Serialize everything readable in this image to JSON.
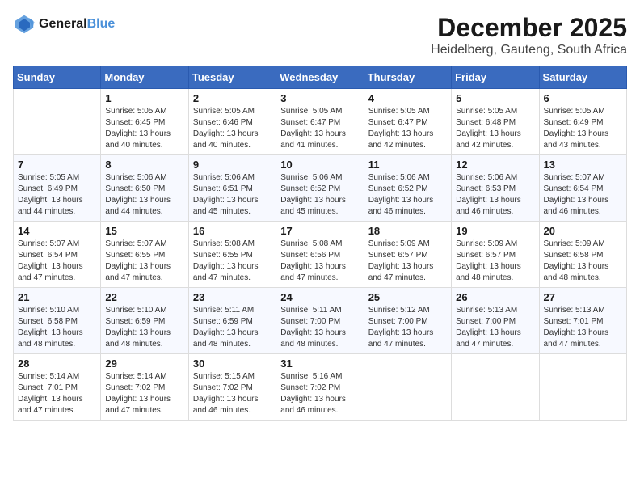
{
  "logo": {
    "line1": "General",
    "line2": "Blue"
  },
  "title": "December 2025",
  "location": "Heidelberg, Gauteng, South Africa",
  "days_of_week": [
    "Sunday",
    "Monday",
    "Tuesday",
    "Wednesday",
    "Thursday",
    "Friday",
    "Saturday"
  ],
  "weeks": [
    [
      {
        "day": "",
        "content": ""
      },
      {
        "day": "1",
        "content": "Sunrise: 5:05 AM\nSunset: 6:45 PM\nDaylight: 13 hours\nand 40 minutes."
      },
      {
        "day": "2",
        "content": "Sunrise: 5:05 AM\nSunset: 6:46 PM\nDaylight: 13 hours\nand 40 minutes."
      },
      {
        "day": "3",
        "content": "Sunrise: 5:05 AM\nSunset: 6:47 PM\nDaylight: 13 hours\nand 41 minutes."
      },
      {
        "day": "4",
        "content": "Sunrise: 5:05 AM\nSunset: 6:47 PM\nDaylight: 13 hours\nand 42 minutes."
      },
      {
        "day": "5",
        "content": "Sunrise: 5:05 AM\nSunset: 6:48 PM\nDaylight: 13 hours\nand 42 minutes."
      },
      {
        "day": "6",
        "content": "Sunrise: 5:05 AM\nSunset: 6:49 PM\nDaylight: 13 hours\nand 43 minutes."
      }
    ],
    [
      {
        "day": "7",
        "content": "Sunrise: 5:05 AM\nSunset: 6:49 PM\nDaylight: 13 hours\nand 44 minutes."
      },
      {
        "day": "8",
        "content": "Sunrise: 5:06 AM\nSunset: 6:50 PM\nDaylight: 13 hours\nand 44 minutes."
      },
      {
        "day": "9",
        "content": "Sunrise: 5:06 AM\nSunset: 6:51 PM\nDaylight: 13 hours\nand 45 minutes."
      },
      {
        "day": "10",
        "content": "Sunrise: 5:06 AM\nSunset: 6:52 PM\nDaylight: 13 hours\nand 45 minutes."
      },
      {
        "day": "11",
        "content": "Sunrise: 5:06 AM\nSunset: 6:52 PM\nDaylight: 13 hours\nand 46 minutes."
      },
      {
        "day": "12",
        "content": "Sunrise: 5:06 AM\nSunset: 6:53 PM\nDaylight: 13 hours\nand 46 minutes."
      },
      {
        "day": "13",
        "content": "Sunrise: 5:07 AM\nSunset: 6:54 PM\nDaylight: 13 hours\nand 46 minutes."
      }
    ],
    [
      {
        "day": "14",
        "content": "Sunrise: 5:07 AM\nSunset: 6:54 PM\nDaylight: 13 hours\nand 47 minutes."
      },
      {
        "day": "15",
        "content": "Sunrise: 5:07 AM\nSunset: 6:55 PM\nDaylight: 13 hours\nand 47 minutes."
      },
      {
        "day": "16",
        "content": "Sunrise: 5:08 AM\nSunset: 6:55 PM\nDaylight: 13 hours\nand 47 minutes."
      },
      {
        "day": "17",
        "content": "Sunrise: 5:08 AM\nSunset: 6:56 PM\nDaylight: 13 hours\nand 47 minutes."
      },
      {
        "day": "18",
        "content": "Sunrise: 5:09 AM\nSunset: 6:57 PM\nDaylight: 13 hours\nand 47 minutes."
      },
      {
        "day": "19",
        "content": "Sunrise: 5:09 AM\nSunset: 6:57 PM\nDaylight: 13 hours\nand 48 minutes."
      },
      {
        "day": "20",
        "content": "Sunrise: 5:09 AM\nSunset: 6:58 PM\nDaylight: 13 hours\nand 48 minutes."
      }
    ],
    [
      {
        "day": "21",
        "content": "Sunrise: 5:10 AM\nSunset: 6:58 PM\nDaylight: 13 hours\nand 48 minutes."
      },
      {
        "day": "22",
        "content": "Sunrise: 5:10 AM\nSunset: 6:59 PM\nDaylight: 13 hours\nand 48 minutes."
      },
      {
        "day": "23",
        "content": "Sunrise: 5:11 AM\nSunset: 6:59 PM\nDaylight: 13 hours\nand 48 minutes."
      },
      {
        "day": "24",
        "content": "Sunrise: 5:11 AM\nSunset: 7:00 PM\nDaylight: 13 hours\nand 48 minutes."
      },
      {
        "day": "25",
        "content": "Sunrise: 5:12 AM\nSunset: 7:00 PM\nDaylight: 13 hours\nand 47 minutes."
      },
      {
        "day": "26",
        "content": "Sunrise: 5:13 AM\nSunset: 7:00 PM\nDaylight: 13 hours\nand 47 minutes."
      },
      {
        "day": "27",
        "content": "Sunrise: 5:13 AM\nSunset: 7:01 PM\nDaylight: 13 hours\nand 47 minutes."
      }
    ],
    [
      {
        "day": "28",
        "content": "Sunrise: 5:14 AM\nSunset: 7:01 PM\nDaylight: 13 hours\nand 47 minutes."
      },
      {
        "day": "29",
        "content": "Sunrise: 5:14 AM\nSunset: 7:02 PM\nDaylight: 13 hours\nand 47 minutes."
      },
      {
        "day": "30",
        "content": "Sunrise: 5:15 AM\nSunset: 7:02 PM\nDaylight: 13 hours\nand 46 minutes."
      },
      {
        "day": "31",
        "content": "Sunrise: 5:16 AM\nSunset: 7:02 PM\nDaylight: 13 hours\nand 46 minutes."
      },
      {
        "day": "",
        "content": ""
      },
      {
        "day": "",
        "content": ""
      },
      {
        "day": "",
        "content": ""
      }
    ]
  ]
}
